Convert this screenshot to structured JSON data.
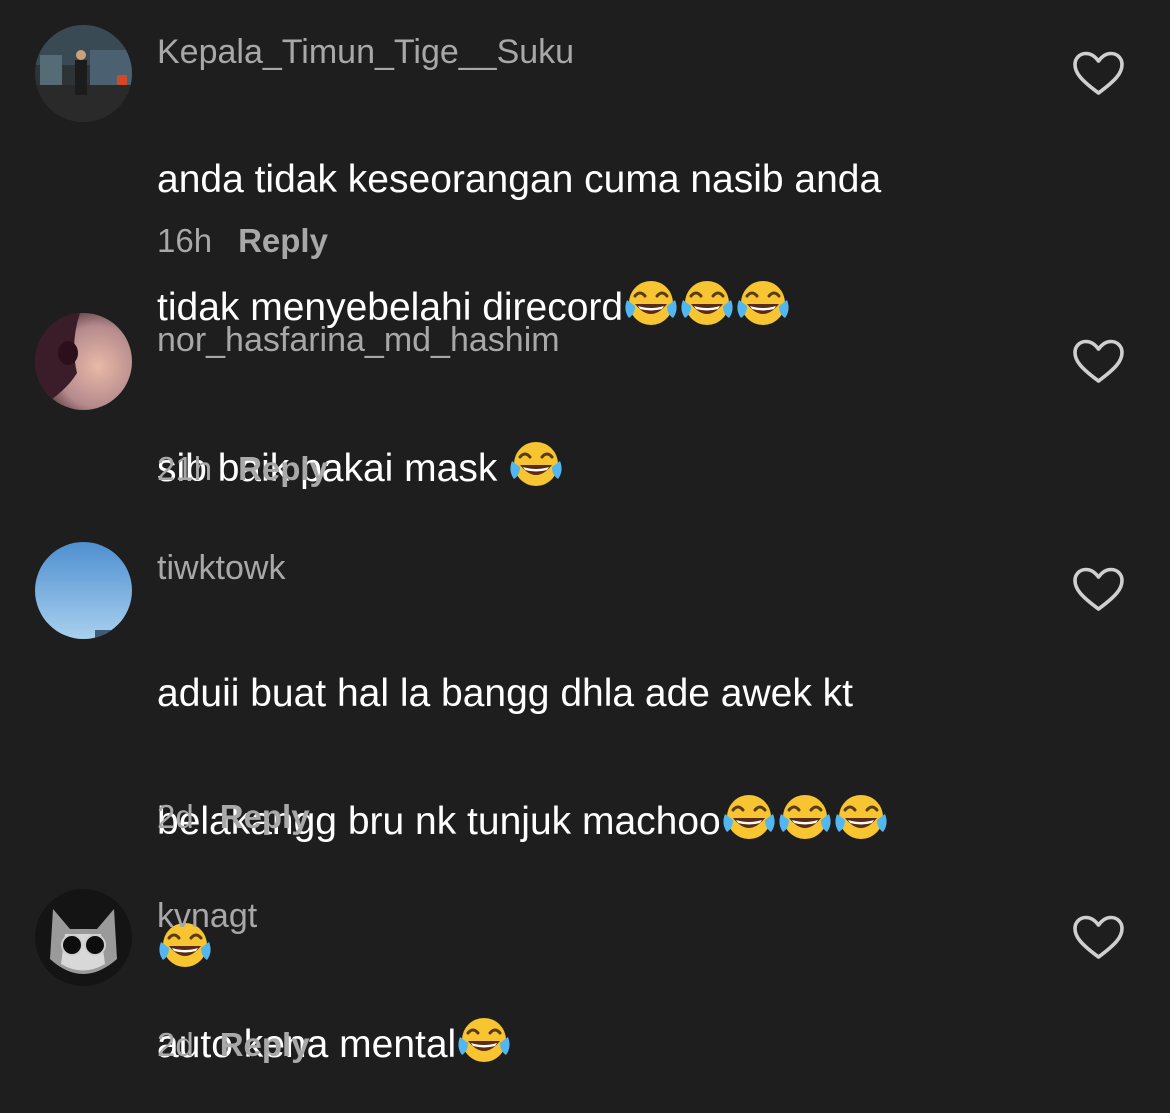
{
  "comments": [
    {
      "username": "Kepala_Timun_Tige__Suku",
      "text_line1": "anda tidak keseorangan cuma nasib anda",
      "text_line2": "tidak menyebelahi direcord",
      "emoji_count": 3,
      "time": "16h",
      "reply_label": "Reply"
    },
    {
      "username": "nor_hasfarina_md_hashim",
      "text_line1": "sib baik pakai mask ",
      "emoji_count": 1,
      "time": "21h",
      "reply_label": "Reply"
    },
    {
      "username": "tiwktowk",
      "text_line1": "aduii buat hal la bangg dhla ade awek kt",
      "text_line2": "belakangg bru nk tunjuk machoo",
      "emoji_count": 4,
      "time": "2d",
      "reply_label": "Reply"
    },
    {
      "username": "kvnagt",
      "text_line1": "auto kena mental",
      "emoji_count": 1,
      "time": "2d",
      "reply_label": "Reply"
    }
  ],
  "icons": {
    "like": "heart-outline-icon",
    "emoji": "face-with-tears-of-joy-emoji"
  },
  "colors": {
    "background": "#1e1e1e",
    "username": "#a8a8a8",
    "text": "#ffffff",
    "meta": "#a8a8a8"
  }
}
